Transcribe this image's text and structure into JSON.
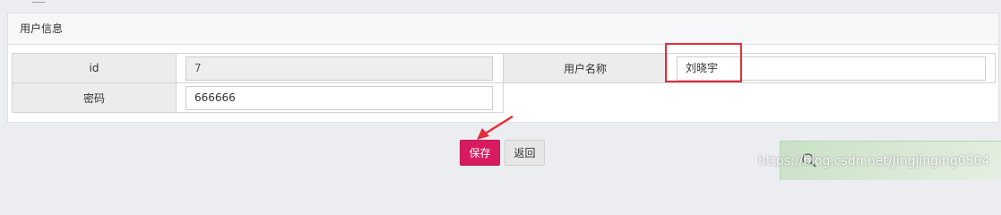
{
  "panel": {
    "title": "用户信息"
  },
  "form": {
    "id_label": "id",
    "id_value": "7",
    "username_label": "用户名称",
    "username_value": "刘晓宇",
    "password_label": "密码",
    "password_value": "666666"
  },
  "actions": {
    "save_label": "保存",
    "back_label": "返回"
  },
  "watermark": {
    "text": "https://blog.csdn.net/Jingjinging0504"
  },
  "colors": {
    "save_button": "#d81b60",
    "annotation_red": "#e52d3a"
  },
  "icons": [
    "magnifier-icon",
    "annotation-arrow-icon"
  ]
}
